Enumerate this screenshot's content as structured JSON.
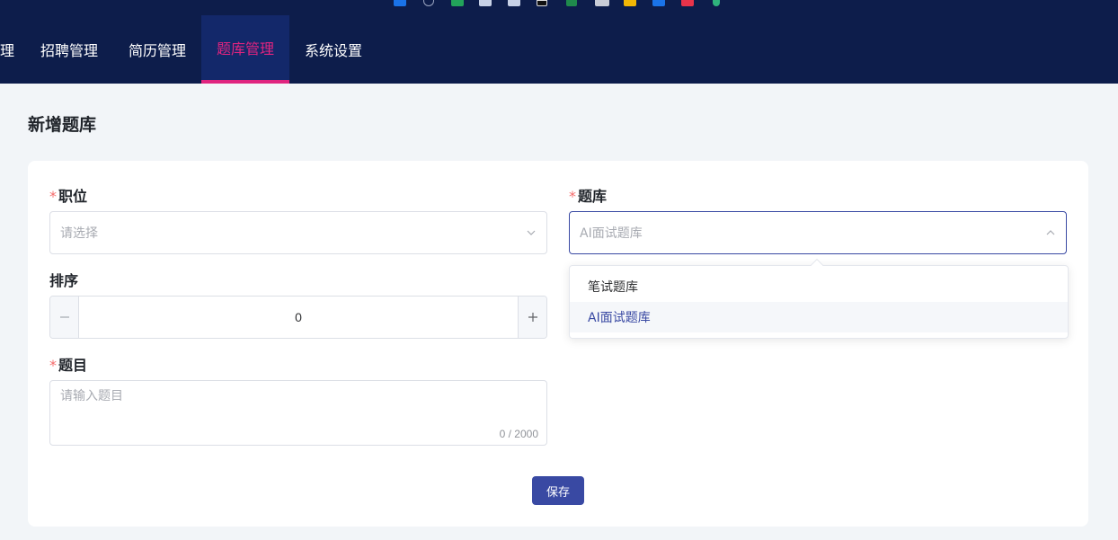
{
  "nav": {
    "items": [
      {
        "label": "理"
      },
      {
        "label": "招聘管理"
      },
      {
        "label": "简历管理"
      },
      {
        "label": "题库管理",
        "active": true
      },
      {
        "label": "系统设置"
      }
    ],
    "accent_color": "#e0247f",
    "background_color": "#0d1d4b"
  },
  "page": {
    "title": "新增题库"
  },
  "form": {
    "required_mark": "*",
    "position": {
      "label": "职位",
      "placeholder": "请选择"
    },
    "bank": {
      "label": "题库",
      "value": "AI面试题库"
    },
    "sort": {
      "label": "排序",
      "value": "0"
    },
    "question": {
      "label": "题目",
      "placeholder": "请输入题目",
      "counter": "0 / 2000"
    },
    "save_label": "保存"
  },
  "dropdown": {
    "options": [
      {
        "label": "笔试题库"
      },
      {
        "label": "AI面试题库",
        "selected": true
      }
    ]
  },
  "colors": {
    "primary": "#3949a3",
    "required": "#f56c6c"
  }
}
